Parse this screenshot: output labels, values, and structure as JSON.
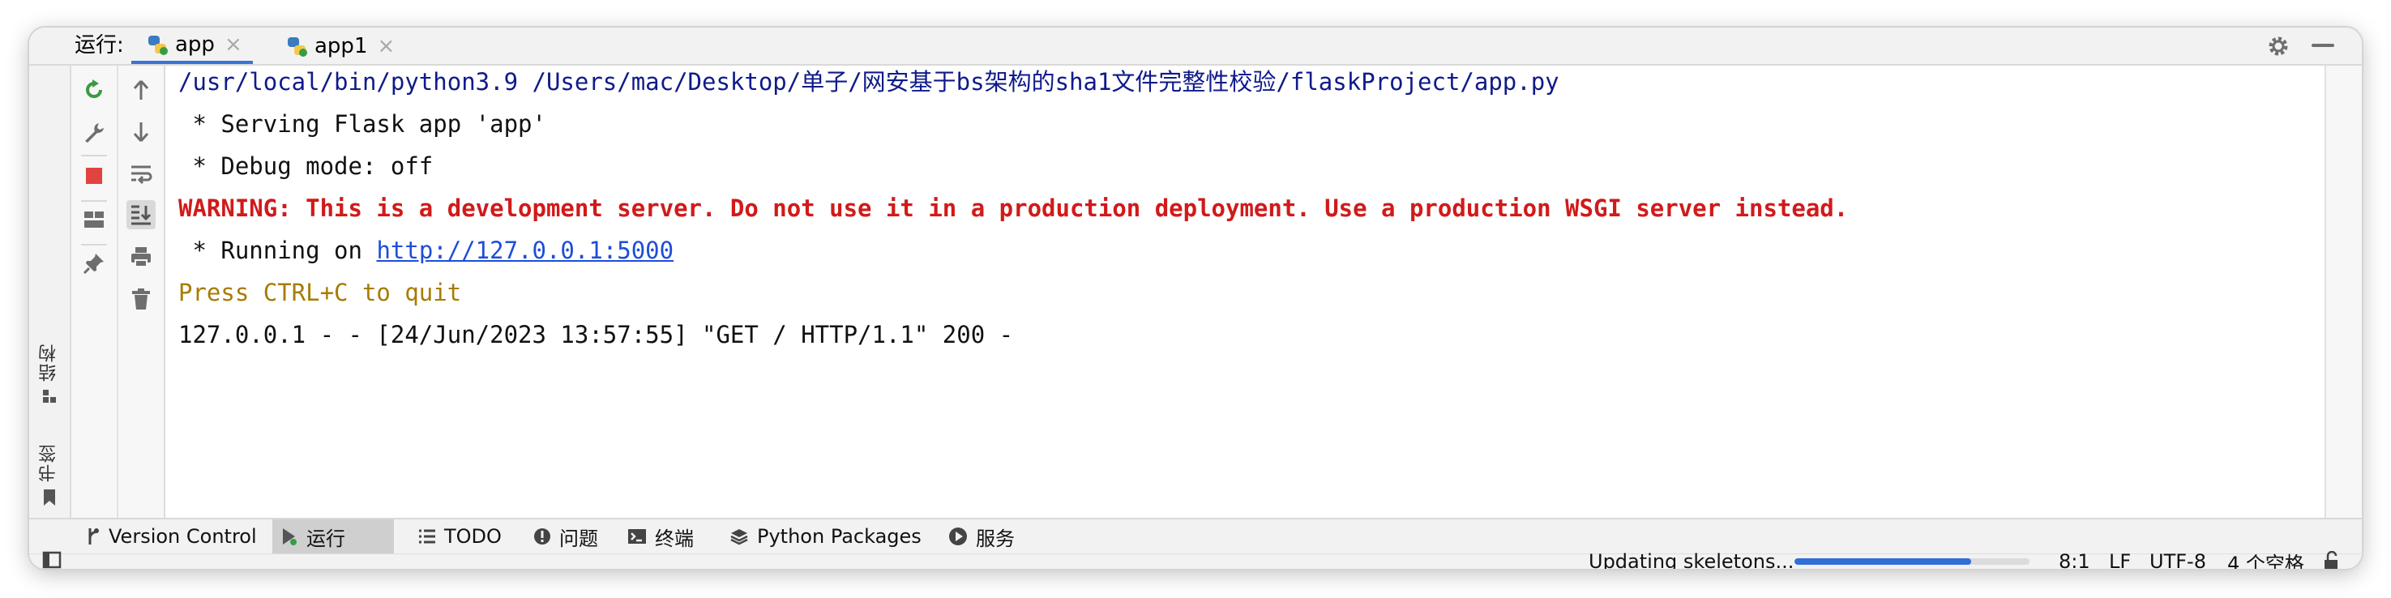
{
  "header": {
    "run_label": "运行:",
    "tabs": [
      {
        "label": "app",
        "active": true
      },
      {
        "label": "app1",
        "active": false
      }
    ]
  },
  "left_strip": {
    "structure": "结构",
    "bookmarks": "书签"
  },
  "console": {
    "command": "/usr/local/bin/python3.9 /Users/mac/Desktop/单子/网安基于bs架构的sha1文件完整性校验/flaskProject/app.py",
    "serving": " * Serving Flask app 'app'",
    "debug": " * Debug mode: off",
    "warning": "WARNING: This is a development server. Do not use it in a production deployment. Use a production WSGI server instead.",
    "running_prefix": " * Running on ",
    "running_url": "http://127.0.0.1:5000",
    "quit_hint": "Press CTRL+C to quit",
    "request_log": "127.0.0.1 - - [24/Jun/2023 13:57:55] \"GET / HTTP/1.1\" 200 -"
  },
  "bottom_tabs": [
    {
      "label": "Version Control",
      "icon": "branch-icon"
    },
    {
      "label": "运行",
      "icon": "run-icon",
      "active": true
    },
    {
      "label": "TODO",
      "icon": "list-icon"
    },
    {
      "label": "问题",
      "icon": "info-icon"
    },
    {
      "label": "终端",
      "icon": "terminal-icon"
    },
    {
      "label": "Python Packages",
      "icon": "layers-icon"
    },
    {
      "label": "服务",
      "icon": "play-circle-icon"
    }
  ],
  "status": {
    "task": "Updating skeletons...",
    "progress": 0.75,
    "position": "8:1",
    "line_sep": "LF",
    "encoding": "UTF-8",
    "indent": "4 个空格"
  },
  "colors": {
    "accent": "#3874d8",
    "warning": "#d11a1a",
    "command": "#0f1a8a",
    "quit": "#a67c00",
    "link": "#1d4ed8",
    "stop": "#e0443e",
    "rerun": "#3a9b43"
  }
}
